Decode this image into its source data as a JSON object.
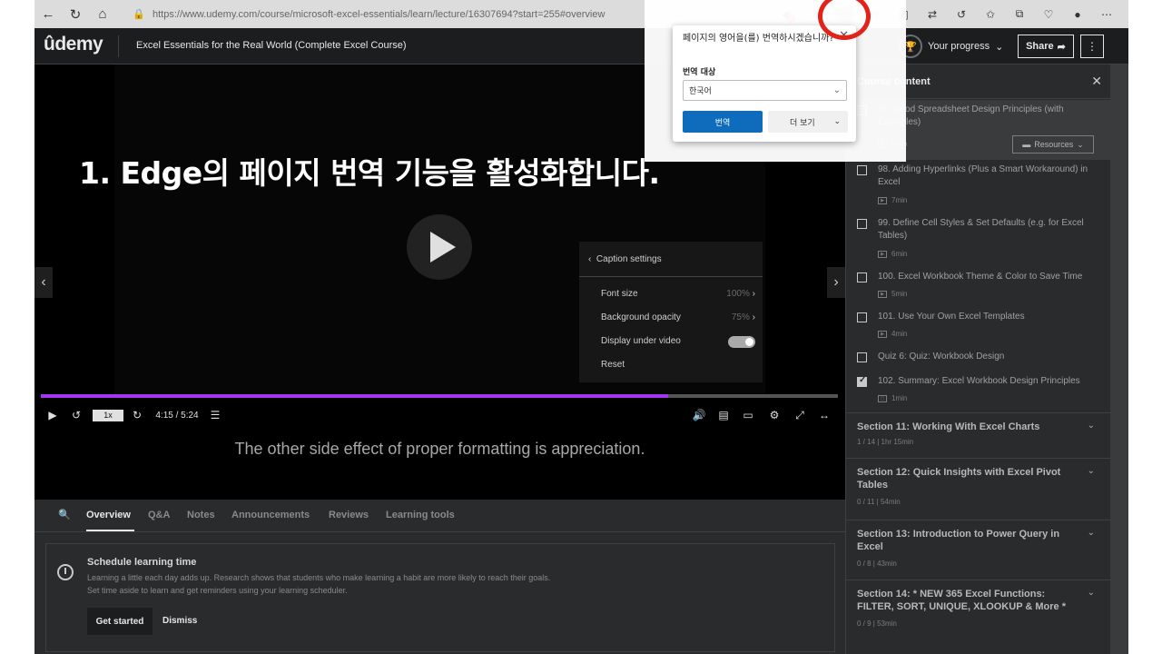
{
  "browser": {
    "url": "https://www.udemy.com/course/microsoft-excel-essentials/learn/lecture/16307694?start=255#overview",
    "translate_icon": "가A"
  },
  "header": {
    "logo": "ûdemy",
    "course_title": "Excel Essentials for the Real World (Complete Excel Course)",
    "progress_label": "Your progress",
    "share_label": "Share",
    "more_label": "⋮"
  },
  "overlay": {
    "headline": "1. Edge의 페이지 번역 기능을 활성화합니다."
  },
  "translate_popup": {
    "title": "페이지의 영어을(를) 번역하시겠습니까?",
    "target_label": "번역 대상",
    "target_value": "한국어",
    "translate_button": "번역",
    "more_button": "더 보기"
  },
  "video": {
    "caption_settings": {
      "header": "Caption settings",
      "rows": [
        {
          "label": "Font size",
          "value": "100%"
        },
        {
          "label": "Background opacity",
          "value": "75%"
        },
        {
          "label": "Display under video",
          "value": ""
        },
        {
          "label": "Reset",
          "value": ""
        }
      ]
    },
    "speed": "1x",
    "time": "4:15 / 5:24",
    "progress_fraction": 0.787,
    "subtitle": "The other side effect of proper formatting is appreciation."
  },
  "sidebar": {
    "title": "Course content",
    "lessons": [
      {
        "title": "97. Good Spreadsheet Design Principles (with Examples)",
        "duration": "5min",
        "checked": false,
        "active": true,
        "resources": "Resources"
      },
      {
        "title": "98. Adding Hyperlinks (Plus a Smart Workaround) in Excel",
        "duration": "7min",
        "checked": false
      },
      {
        "title": "99. Define Cell Styles & Set Defaults (e.g. for Excel Tables)",
        "duration": "6min",
        "checked": false
      },
      {
        "title": "100. Excel Workbook Theme & Color to Save Time",
        "duration": "5min",
        "checked": false
      },
      {
        "title": "101. Use Your Own Excel Templates",
        "duration": "4min",
        "checked": false
      },
      {
        "title": "Quiz 6: Quiz: Workbook Design",
        "duration": "",
        "checked": false
      },
      {
        "title": "102. Summary: Excel Workbook Design Principles",
        "duration": "1min",
        "checked": true
      }
    ],
    "sections": [
      {
        "title": "Section 11: Working With Excel Charts",
        "meta": "1 / 14 | 1hr 15min"
      },
      {
        "title": "Section 12: Quick Insights with Excel Pivot Tables",
        "meta": "0 / 11 | 54min"
      },
      {
        "title": "Section 13: Introduction to Power Query in Excel",
        "meta": "0 / 8 | 43min"
      },
      {
        "title": "Section 14: * NEW 365 Excel Functions: FILTER, SORT, UNIQUE, XLOOKUP & More *",
        "meta": "0 / 9 | 53min"
      }
    ]
  },
  "tabs": [
    "Overview",
    "Q&A",
    "Notes",
    "Announcements",
    "Reviews",
    "Learning tools"
  ],
  "schedule": {
    "title": "Schedule learning time",
    "line1": "Learning a little each day adds up. Research shows that students who make learning a habit are more likely to reach their goals.",
    "line2": "Set time aside to learn and get reminders using your learning scheduler.",
    "get_started": "Get started",
    "dismiss": "Dismiss"
  }
}
